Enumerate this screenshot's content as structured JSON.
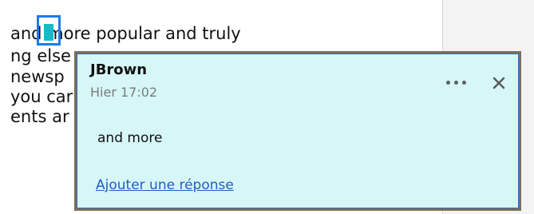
{
  "document": {
    "lines": [
      "and more popular and truly",
      "ng else",
      " newsp",
      "you car",
      "ents ar"
    ]
  },
  "comment": {
    "author": "JBrown",
    "timestamp": "Hier 17:02",
    "body": "and more",
    "reply_label": "Ajouter une réponse",
    "more_icon": "ellipsis-icon",
    "close_icon": "close-icon",
    "colors": {
      "background": "#d6f6f8",
      "border": "#7b6f5a",
      "link": "#1f5fbf",
      "anchor": "#1e7ae6",
      "anchor_fill": "#19b9c7"
    }
  }
}
